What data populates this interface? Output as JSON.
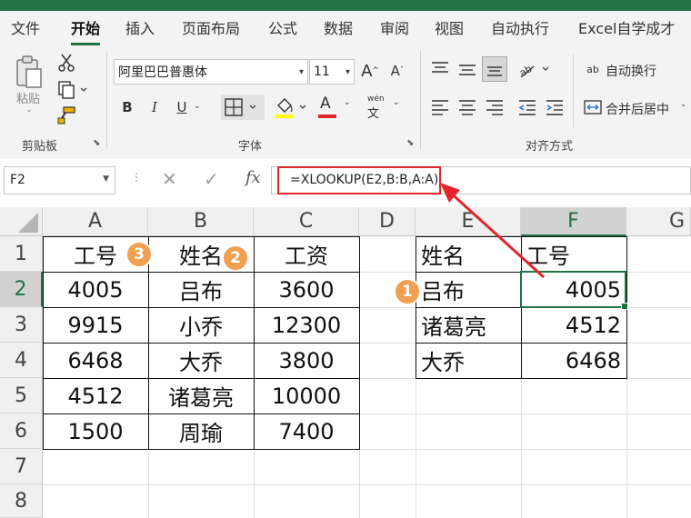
{
  "tabs": [
    "文件",
    "开始",
    "插入",
    "页面布局",
    "公式",
    "数据",
    "审阅",
    "视图",
    "自动执行",
    "Excel自学成才"
  ],
  "active_tab": "开始",
  "ribbon": {
    "clipboard": {
      "paste_label": "粘贴",
      "group_label": "剪贴板"
    },
    "font": {
      "font_name": "阿里巴巴普惠体",
      "font_size": "11",
      "bold": "B",
      "italic": "I",
      "underline": "U",
      "font_color_glyph": "A",
      "pinyin_glyph": "wén",
      "group_label": "字体"
    },
    "alignment": {
      "wrap_text": "自动换行",
      "merge_center": "合并后居中",
      "group_label": "对齐方式",
      "wrap_glyph": "ab"
    }
  },
  "formula_bar": {
    "name_box": "F2",
    "cancel": "✕",
    "enter": "✓",
    "fx": "fx",
    "formula": "=XLOOKUP(E2,B:B,A:A)"
  },
  "columns": [
    "A",
    "B",
    "C",
    "D",
    "E",
    "F",
    "G"
  ],
  "selected_column": "F",
  "rows": [
    "1",
    "2",
    "3",
    "4",
    "5",
    "6",
    "7",
    "8"
  ],
  "selected_row": "2",
  "table1": {
    "headers": [
      "工号",
      "姓名",
      "工资"
    ],
    "rows": [
      [
        "4005",
        "吕布",
        "3600"
      ],
      [
        "9915",
        "小乔",
        "12300"
      ],
      [
        "6468",
        "大乔",
        "3800"
      ],
      [
        "4512",
        "诸葛亮",
        "10000"
      ],
      [
        "1500",
        "周瑜",
        "7400"
      ]
    ]
  },
  "table2": {
    "headers": [
      "姓名",
      "工号"
    ],
    "rows": [
      [
        "吕布",
        "4005"
      ],
      [
        "诸葛亮",
        "4512"
      ],
      [
        "大乔",
        "6468"
      ]
    ]
  },
  "badges": [
    "1",
    "2",
    "3"
  ],
  "colors": {
    "excel_green": "#217346",
    "annotation_red": "#e0262b",
    "badge_orange": "#f0a050"
  }
}
